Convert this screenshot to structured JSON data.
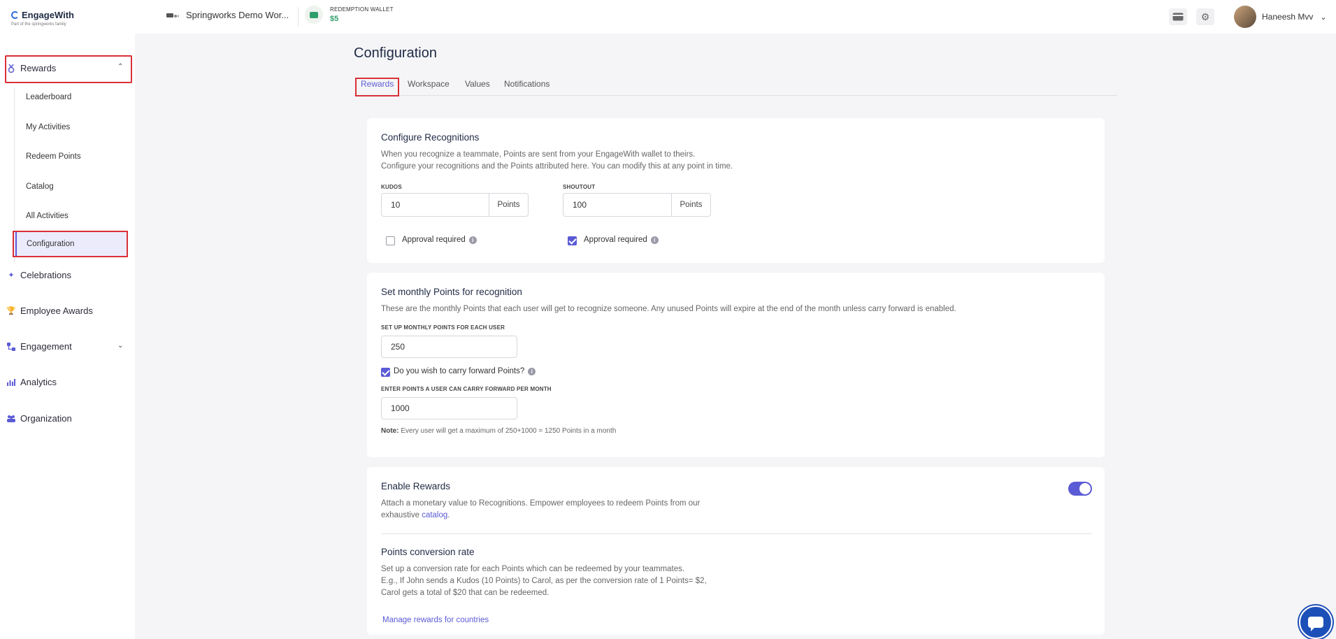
{
  "app": {
    "name": "EngageWith",
    "tagline": "Part of the springworks family"
  },
  "topbar": {
    "workspace": "Springworks Demo Wor...",
    "wallet_label": "REDEMPTION WALLET",
    "wallet_value": "$5",
    "user_name": "Haneesh Mvv"
  },
  "sidebar": {
    "rewards_label": "Rewards",
    "sub_items": [
      "Leaderboard",
      "My Activities",
      "Redeem Points",
      "Catalog",
      "All Activities",
      "Configuration"
    ],
    "celebrations": "Celebrations",
    "employee_awards": "Employee Awards",
    "engagement": "Engagement",
    "analytics": "Analytics",
    "organization": "Organization"
  },
  "main": {
    "title": "Configuration",
    "tabs": [
      "Rewards",
      "Workspace",
      "Values",
      "Notifications"
    ]
  },
  "recognitions": {
    "title": "Configure Recognitions",
    "desc1": "When you recognize a teammate, Points are sent from your EngageWith wallet to theirs.",
    "desc2": "Configure your recognitions and the Points attributed here. You can modify this at any point in time.",
    "kudos_label": "KUDOS",
    "kudos_value": "10",
    "shoutout_label": "SHOUTOUT",
    "shoutout_value": "100",
    "points_suffix": "Points",
    "approval_label": "Approval required",
    "kudos_approval": false,
    "shoutout_approval": true
  },
  "monthly": {
    "title": "Set monthly Points for recognition",
    "desc": "These are the monthly Points that each user will get to recognize someone. Any unused Points will expire at the end of the month unless carry forward is enabled.",
    "points_label": "SET UP MONTHLY POINTS FOR EACH USER",
    "points_value": "250",
    "carry_label": "Do you wish to carry forward Points?",
    "carry_enabled": true,
    "carry_points_label": "ENTER POINTS A USER CAN CARRY FORWARD PER MONTH",
    "carry_points_value": "1000",
    "note_prefix": "Note:",
    "note_text": "Every user will get a maximum of 250+1000 = 1250 Points in a month"
  },
  "enable_rewards": {
    "title": "Enable Rewards",
    "desc1": "Attach a monetary value to Recognitions. Empower employees to redeem Points from our",
    "desc2_prefix": "exhaustive",
    "desc2_link": "catalog",
    "desc2_suffix": ".",
    "enabled": true,
    "conversion_title": "Points conversion rate",
    "conversion_desc1": "Set up a conversion rate for each Points which can be redeemed by your teammates.",
    "conversion_desc2": "E.g., If John sends a Kudos (10 Points) to Carol, as per the conversion rate of 1 Points= $2,",
    "conversion_desc3": "Carol gets a total of $20 that can be redeemed.",
    "manage_link": "Manage rewards for countries"
  },
  "colors": {
    "accent": "#5b5bd6",
    "highlight_box": "#d93036",
    "wallet_green": "#2f9e6a"
  }
}
